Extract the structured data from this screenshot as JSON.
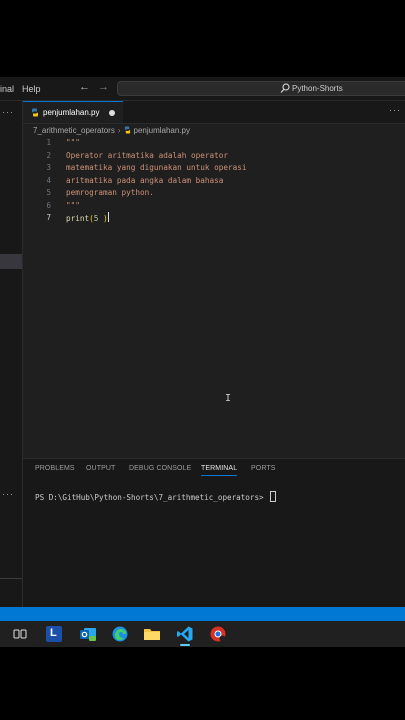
{
  "titlebar": {
    "menu_partial": "inal",
    "menu_help": "Help",
    "back_glyph": "←",
    "forward_glyph": "→",
    "search_text": "Python-Shorts"
  },
  "sidebar": {
    "more_glyph": "···"
  },
  "tabs": {
    "active_label": "penjumlahan.py",
    "more_glyph": "···"
  },
  "breadcrumb": {
    "folder": "7_arithmetic_operators",
    "separator": "›",
    "file": "penjumlahan.py"
  },
  "editor": {
    "line_numbers": [
      "1",
      "2",
      "3",
      "4",
      "5",
      "6",
      "7"
    ],
    "lines": {
      "l1": "\"\"\"",
      "l2": "Operator aritmatika adalah operator",
      "l3": "matematika yang digunakan untuk operasi",
      "l4": "aritmatika pada angka dalam bahasa",
      "l5": "pemrograman python.",
      "l6": "\"\"\"",
      "l7_fn": "print",
      "l7_open": "(",
      "l7_num": "5 ",
      "l7_close": ")"
    },
    "ibeam_glyph": "I"
  },
  "panel": {
    "tabs": [
      "PROBLEMS",
      "OUTPUT",
      "DEBUG CONSOLE",
      "TERMINAL",
      "PORTS"
    ],
    "active_tab": "TERMINAL",
    "terminal_prompt": "PS D:\\GitHub\\Python-Shorts\\7_arithmetic_operators> "
  },
  "taskbar": {
    "apps": [
      "task-view",
      "l-app",
      "outlook-new",
      "edge",
      "file-explorer",
      "vscode",
      "chrome-profile"
    ],
    "l_app_letter": "L"
  },
  "colors": {
    "accent": "#0078d4",
    "string": "#ce9178",
    "function": "#dcdcaa",
    "number": "#b5cea8",
    "bracket": "#ffd700"
  }
}
